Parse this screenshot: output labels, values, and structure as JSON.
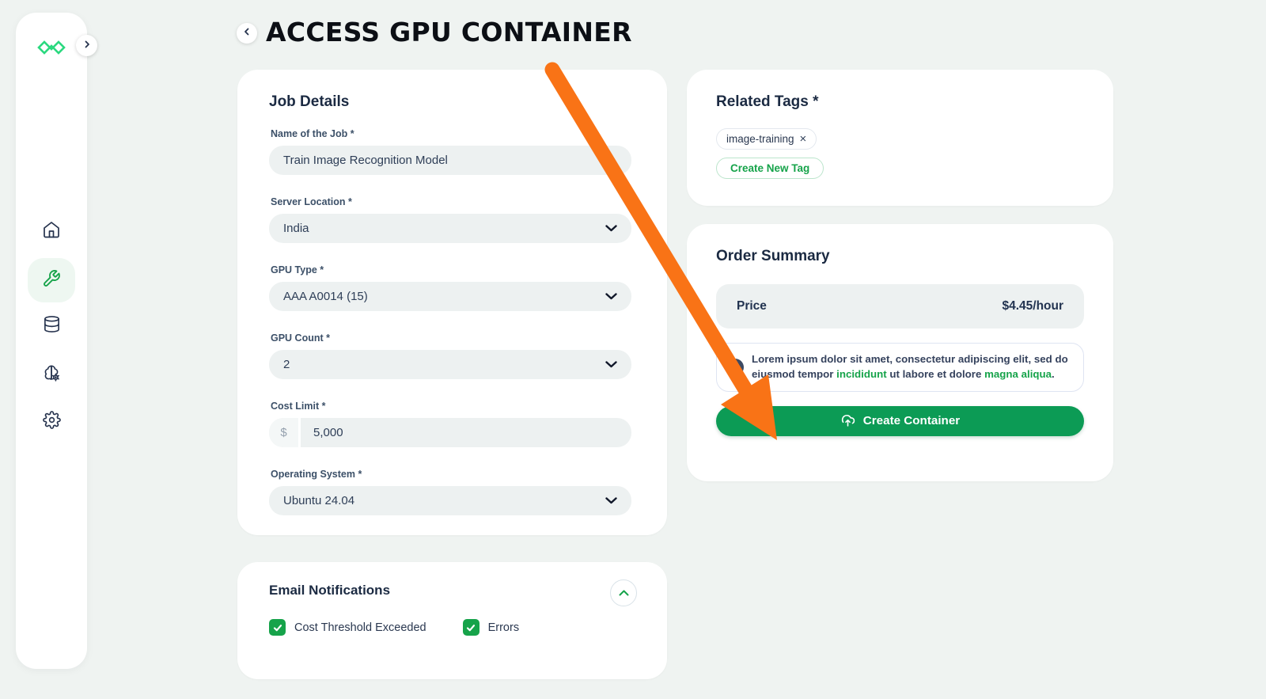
{
  "page": {
    "title": "ACCESS GPU CONTAINER"
  },
  "sidebar": {
    "logo": "infinity-logo",
    "items": [
      {
        "icon": "home"
      },
      {
        "icon": "wrench",
        "active": true
      },
      {
        "icon": "database"
      },
      {
        "icon": "ai-brain"
      },
      {
        "icon": "settings"
      }
    ]
  },
  "job_details": {
    "heading": "Job Details",
    "name_label": "Name of the Job *",
    "name_value": "Train Image Recognition Model",
    "server_label": "Server Location *",
    "server_value": "India",
    "gpu_type_label": "GPU Type *",
    "gpu_type_value": "AAA A0014 (15)",
    "gpu_count_label": "GPU Count *",
    "gpu_count_value": "2",
    "cost_label": "Cost Limit *",
    "cost_prefix": "$",
    "cost_value": "5,000",
    "os_label": "Operating System *",
    "os_value": "Ubuntu 24.04"
  },
  "email_notifications": {
    "heading": "Email Notifications",
    "checkbox1": "Cost Threshold Exceeded",
    "checkbox2": "Errors"
  },
  "related_tags": {
    "heading": "Related Tags *",
    "tag1": "image-training",
    "tag1_remove": "×",
    "create_button": "Create New Tag"
  },
  "order_summary": {
    "heading": "Order Summary",
    "price_label": "Price",
    "price_value": "$4.45/hour",
    "info": {
      "seg1": "Lorem ipsum dolor sit amet, consectetur adipiscing elit, sed do eiusmod tempor ",
      "seg2": "incididunt",
      "seg3": " ut labore et dolore ",
      "seg4": "magna aliqua",
      "seg5": "."
    },
    "create_button": "Create Container"
  },
  "colors": {
    "background": "#eff3f1",
    "accent_green": "#16a34a",
    "button_green": "#0c9b55",
    "logo_green": "#2bd97f",
    "arrow_orange": "#f97316",
    "navy_icon": "#25324d",
    "field_gray": "#edf1f1"
  }
}
